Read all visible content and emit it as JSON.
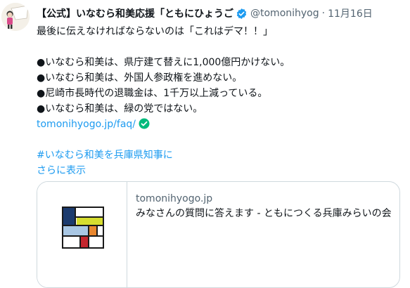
{
  "author": {
    "display_name": "【公式】いなむら和美応援「ともにひょうご",
    "handle": "@tomonihyog",
    "separator": "·",
    "timestamp": "11月16日",
    "verified_color": "#1d9bf0"
  },
  "tweet": {
    "line1": "最後に伝えなければならないのは「これはデマ！！」",
    "bullets": [
      "●いなむら和美は、県庁建て替えに1,000億円かけない。",
      "●いなむら和美は、外国人参政権を進めない。",
      "●尼崎市長時代の退職金は、1千万以上減っている。",
      "●いなむら和美は、緑の党ではない。"
    ],
    "link": "tomonihyogo.jp/faq/",
    "hashtag": "#いなむら和美を兵庫県知事に",
    "show_more": "さらに表示"
  },
  "card": {
    "domain": "tomonihyogo.jp",
    "title": "みなさんの質問に答えます - ともにつくる兵庫みらいの会"
  },
  "colors": {
    "link": "#1d9bf0",
    "check_green": "#00ba7c",
    "text_secondary": "#536471"
  }
}
